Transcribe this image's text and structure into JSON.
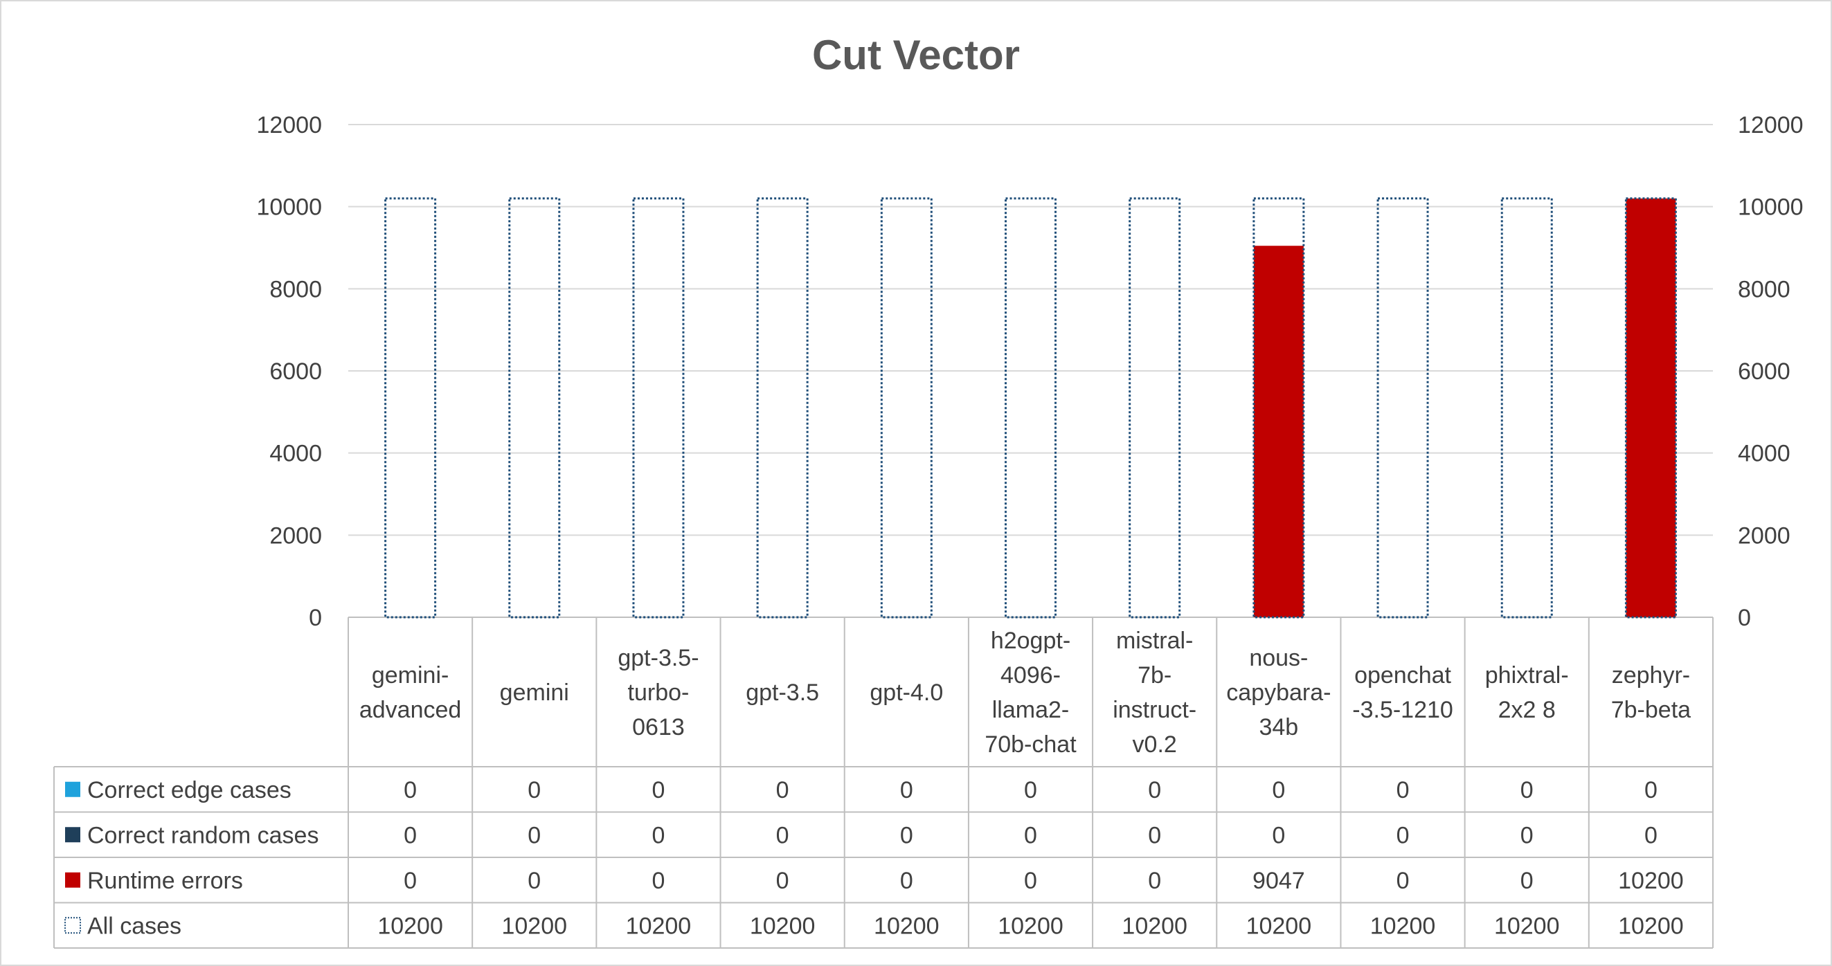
{
  "chart_data": {
    "type": "bar",
    "title": "Cut Vector",
    "categories": [
      [
        "gemini-",
        "advanced"
      ],
      [
        "gemini"
      ],
      [
        "gpt-3.5-",
        "turbo-",
        "0613"
      ],
      [
        "gpt-3.5"
      ],
      [
        "gpt-4.0"
      ],
      [
        "h2ogpt-",
        "4096-",
        "llama2-",
        "70b-chat"
      ],
      [
        "mistral-",
        "7b-",
        "instruct-",
        "v0.2"
      ],
      [
        "nous-",
        "capybara-",
        "34b"
      ],
      [
        "openchat",
        "-3.5-1210"
      ],
      [
        "phixtral-",
        "2x2 8"
      ],
      [
        "zephyr-",
        "7b-beta"
      ]
    ],
    "series": [
      {
        "name": "Correct edge cases",
        "color": "#1fa2dc",
        "marker": "solid",
        "values": [
          0,
          0,
          0,
          0,
          0,
          0,
          0,
          0,
          0,
          0,
          0
        ]
      },
      {
        "name": "Correct random cases",
        "color": "#1f3f5a",
        "marker": "solid",
        "values": [
          0,
          0,
          0,
          0,
          0,
          0,
          0,
          0,
          0,
          0,
          0
        ]
      },
      {
        "name": "Runtime errors",
        "color": "#c00000",
        "marker": "solid",
        "values": [
          0,
          0,
          0,
          0,
          0,
          0,
          0,
          9047,
          0,
          0,
          10200
        ]
      },
      {
        "name": "All cases",
        "color": "#1f4e79",
        "marker": "dotted-outline",
        "values": [
          10200,
          10200,
          10200,
          10200,
          10200,
          10200,
          10200,
          10200,
          10200,
          10200,
          10200
        ]
      }
    ],
    "yticks": [
      "0",
      "2000",
      "4000",
      "6000",
      "8000",
      "10000",
      "12000"
    ],
    "ylim": [
      0,
      12000
    ],
    "secondary_yticks": [
      "0",
      "2000",
      "4000",
      "6000",
      "8000",
      "10000",
      "12000"
    ],
    "grid": true,
    "data_table": true
  }
}
